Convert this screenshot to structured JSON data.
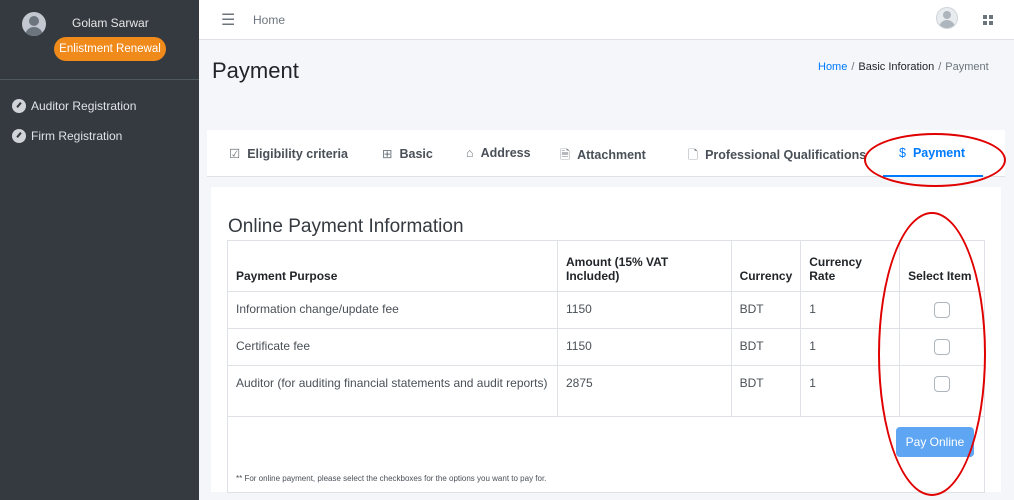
{
  "sidebar": {
    "user_name": "Golam Sarwar",
    "badge": "Enlistment Renewal",
    "items": [
      {
        "label": "Auditor Registration",
        "icon": "dashboard-icon"
      },
      {
        "label": "Firm Registration",
        "icon": "dashboard-icon"
      }
    ]
  },
  "topbar": {
    "home": "Home",
    "menu_icon": "hamburger-icon",
    "avatar_icon": "user-icon",
    "apps_icon": "grid-icon"
  },
  "page": {
    "title": "Payment",
    "breadcrumb": [
      "Home",
      "Basic Inforation",
      "Payment"
    ]
  },
  "tabs": [
    {
      "label": "Eligibility criteria",
      "icon": "checkbox-icon",
      "glyph": "☑"
    },
    {
      "label": "Basic",
      "icon": "grid-icon",
      "glyph": "⊞"
    },
    {
      "label": "Address",
      "icon": "home-icon",
      "glyph": "⌂"
    },
    {
      "label": "Attachment",
      "icon": "file-image-icon",
      "glyph": "🗎"
    },
    {
      "label": "Professional Qualifications",
      "icon": "file-icon",
      "glyph": "🗋"
    },
    {
      "label": "Payment",
      "icon": "dollar-icon",
      "glyph": "$",
      "active": true
    }
  ],
  "payment": {
    "section_title": "Online Payment Information",
    "headers": [
      "Payment Purpose",
      "Amount (15% VAT Included)",
      "Currency",
      "Currency Rate",
      "Select Item"
    ],
    "rows": [
      {
        "purpose": "Information change/update fee",
        "amount": "1150",
        "currency": "BDT",
        "rate": "1",
        "selected": false
      },
      {
        "purpose": "Certificate fee",
        "amount": "1150",
        "currency": "BDT",
        "rate": "1",
        "selected": false
      },
      {
        "purpose": "Auditor (for auditing financial statements and audit reports)",
        "amount": "2875",
        "currency": "BDT",
        "rate": "1",
        "selected": false
      }
    ],
    "note": "** For online payment, please select the checkboxes for the options you want to pay for.",
    "pay_button": "Pay Online"
  },
  "colors": {
    "sidebar": "#343a40",
    "accent": "#007bff",
    "badge": "#f08a1b",
    "pay_button": "#5ea6f3",
    "annotation": "#e00000"
  }
}
